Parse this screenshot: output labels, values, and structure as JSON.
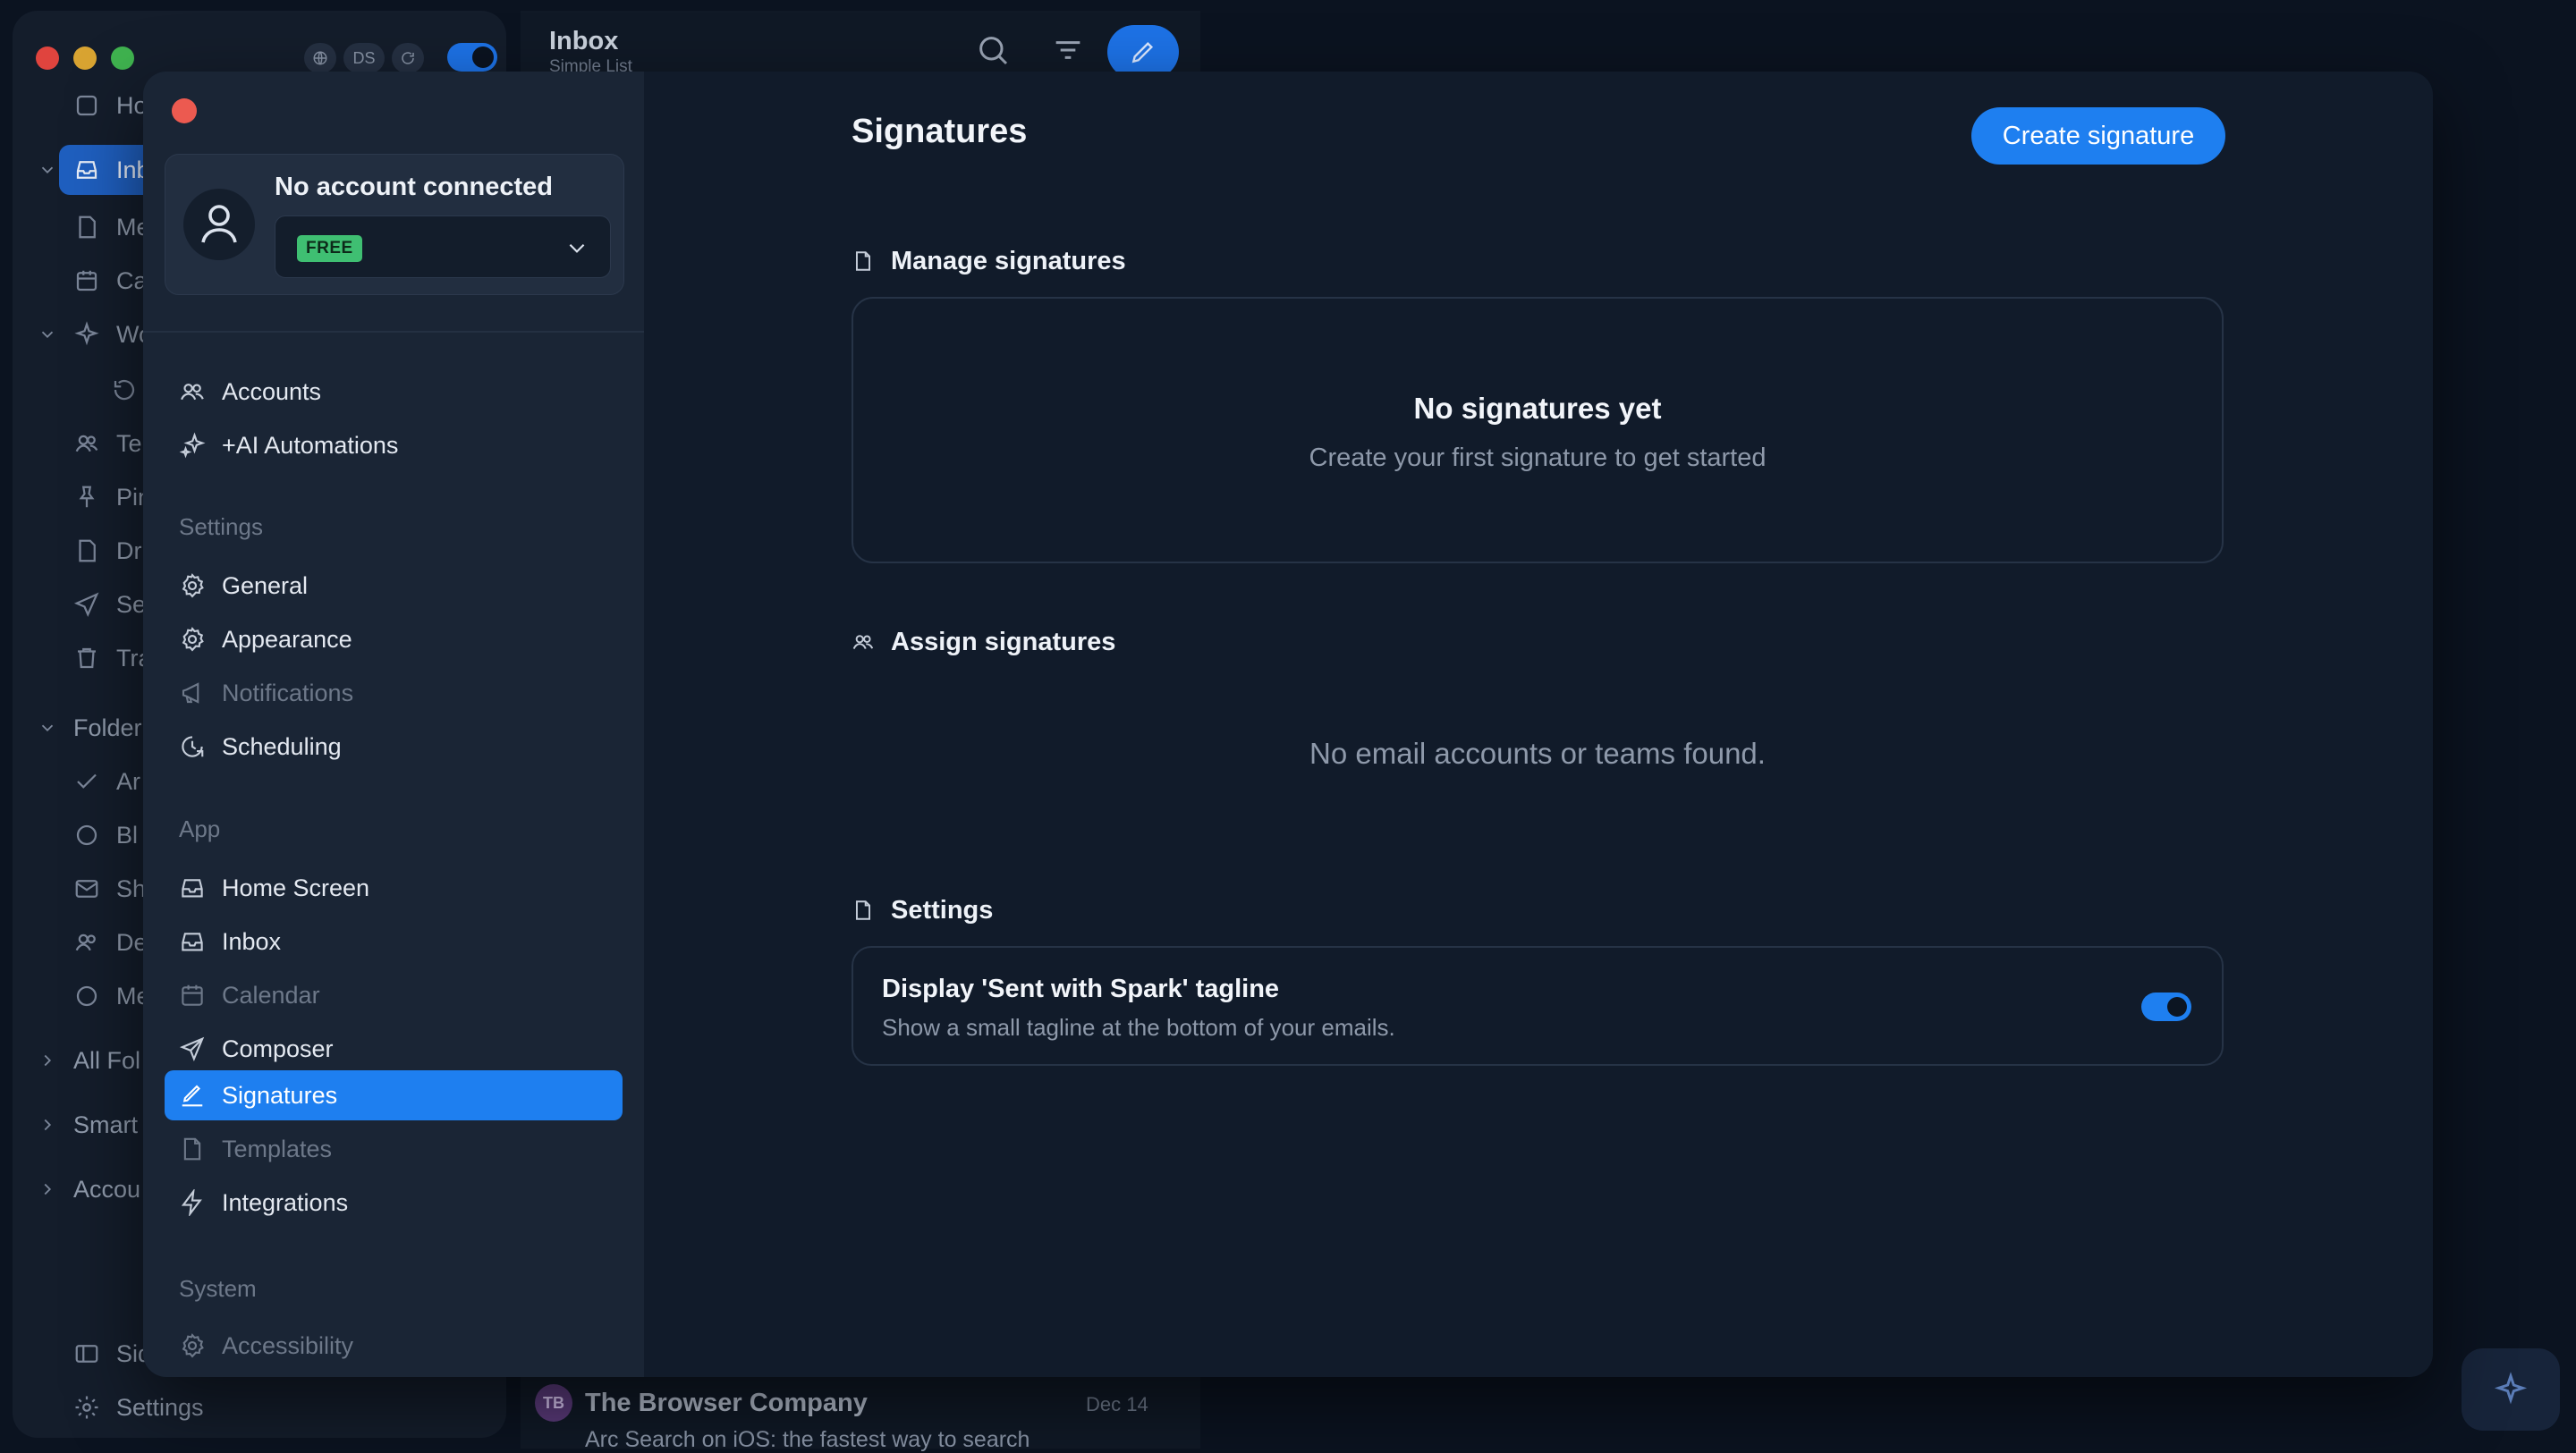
{
  "background": {
    "top_pill": "DS",
    "sidebar": {
      "items": [
        {
          "label": "Ho"
        },
        {
          "label": "Inb"
        },
        {
          "label": "Me"
        },
        {
          "label": "Ca"
        },
        {
          "label": "Wo"
        },
        {
          "label": ""
        },
        {
          "label": "Te"
        },
        {
          "label": "Pin"
        },
        {
          "label": "Dr"
        },
        {
          "label": "Se"
        },
        {
          "label": "Tra"
        },
        {
          "label": "Folder"
        },
        {
          "label": "Ar"
        },
        {
          "label": "Bl"
        },
        {
          "label": "Sh"
        },
        {
          "label": "De"
        },
        {
          "label": "Me"
        },
        {
          "label": "All Fol"
        },
        {
          "label": "Smart"
        },
        {
          "label": "Accou"
        },
        {
          "label": "Sid"
        },
        {
          "label": "Settings"
        }
      ]
    },
    "list_header": {
      "title": "Inbox",
      "subtitle": "Simple List"
    },
    "mail_preview": {
      "avatar_initials": "TB",
      "sender": "The Browser Company",
      "date": "Dec 14",
      "subject": "Arc Search on iOS: the fastest way to search"
    }
  },
  "modal": {
    "account": {
      "name": "No account connected",
      "plan": "FREE"
    },
    "nav_top": [
      {
        "label": "Accounts",
        "icon": "users-icon"
      },
      {
        "label": "+AI Automations",
        "icon": "sparkle-icon"
      }
    ],
    "sections": [
      {
        "title": "Settings",
        "items": [
          {
            "label": "General",
            "icon": "gear-icon"
          },
          {
            "label": "Appearance",
            "icon": "gear-icon"
          },
          {
            "label": "Notifications",
            "icon": "megaphone-icon"
          },
          {
            "label": "Scheduling",
            "icon": "clock-icon"
          }
        ]
      },
      {
        "title": "App",
        "items": [
          {
            "label": "Home Screen",
            "icon": "inbox-tray-icon"
          },
          {
            "label": "Inbox",
            "icon": "inbox-tray-icon"
          },
          {
            "label": "Calendar",
            "icon": "calendar-icon"
          },
          {
            "label": "Composer",
            "icon": "paper-plane-icon"
          },
          {
            "label": "Signatures",
            "icon": "signature-icon"
          },
          {
            "label": "Templates",
            "icon": "template-icon"
          },
          {
            "label": "Integrations",
            "icon": "lightning-icon"
          }
        ]
      },
      {
        "title": "System",
        "items": [
          {
            "label": "Accessibility",
            "icon": "gear-icon"
          }
        ]
      }
    ],
    "active_item": "Signatures",
    "main": {
      "title": "Signatures",
      "create_button": "Create signature",
      "manage": {
        "heading": "Manage signatures",
        "empty_title": "No signatures yet",
        "empty_subtitle": "Create your first signature to get started"
      },
      "assign": {
        "heading": "Assign signatures",
        "empty_text": "No email accounts or teams found."
      },
      "settings": {
        "heading": "Settings",
        "tagline_title": "Display 'Sent with Spark' tagline",
        "tagline_desc": "Show a small tagline at the bottom of your emails.",
        "tagline_enabled": true
      }
    }
  },
  "colors": {
    "accent": "#1e7ff0",
    "free_badge": "#3fbf72",
    "close_button": "#ec5a50",
    "modal_bg": "#111b2a",
    "sidebar_bg": "#1a2535"
  }
}
